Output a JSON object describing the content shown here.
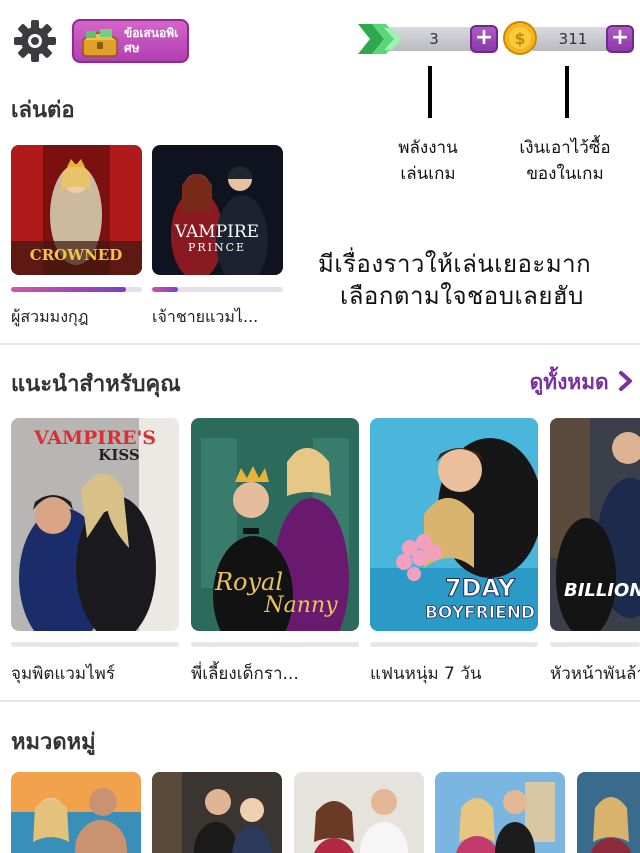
{
  "header": {
    "settings_icon": "gear-icon",
    "offer_label": "ข้อเสนอพิเศษ",
    "energy_value": "3",
    "coins_value": "311",
    "plus_symbol": "+"
  },
  "annotations": {
    "energy_note_line1": "พลังงาน",
    "energy_note_line2": "เล่นเกม",
    "coins_note_line1": "เงินเอาไว้ซื้อ",
    "coins_note_line2": "ของในเกม",
    "stories_note_line1": "มีเรื่องราวให้เล่นเยอะมาก",
    "stories_note_line2": "เลือกตามใจชอบเลยฮับ"
  },
  "continue_section": {
    "title": "เล่นต่อ",
    "items": [
      {
        "caption": "ผู้สวมมงกุฎ",
        "cover_title": "CROWNED",
        "progress": 0.88
      },
      {
        "caption": "เจ้าชายแวมไ...",
        "cover_title": "VAMPIRE",
        "cover_subtitle": "PRINCE",
        "progress": 0.2
      }
    ]
  },
  "recommend_section": {
    "title": "แนะนำสำหรับคุณ",
    "see_all": "ดูทั้งหมด",
    "items": [
      {
        "caption": "จุมพิตแวมไพร์",
        "cover_title": "VAMPIRE'S",
        "cover_subtitle": "KISS"
      },
      {
        "caption": "พี่เลี้ยงเด็กรา...",
        "cover_title": "Royal",
        "cover_subtitle": "Nanny"
      },
      {
        "caption": "แฟนหนุ่ม 7 วัน",
        "cover_title": "7DAY",
        "cover_subtitle": "BOYFRIEND"
      },
      {
        "caption": "หัวหน้าพันล้า",
        "cover_title": "BILLION"
      }
    ]
  },
  "category_section": {
    "title": "หมวดหมู่"
  },
  "colors": {
    "accent_purple": "#7b2fa0",
    "progress_pink": "#d452a7"
  }
}
